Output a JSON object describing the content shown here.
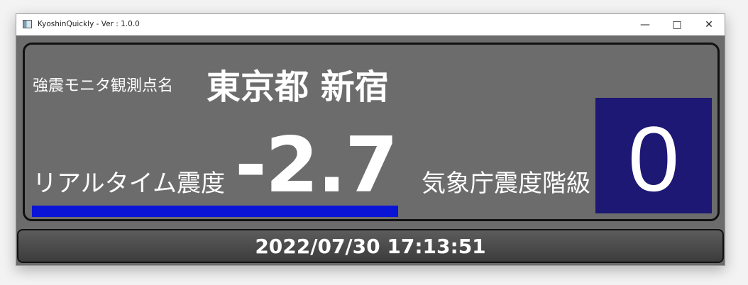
{
  "window": {
    "title": "KyoshinQuickly - Ver : 1.0.0",
    "icon": "app-window-icon",
    "controls": {
      "minimize": "—",
      "maximize": "□",
      "close": "✕"
    }
  },
  "station": {
    "label": "強震モニタ観測点名",
    "name": "東京都 新宿"
  },
  "realtime": {
    "label": "リアルタイム震度",
    "value": "-2.7",
    "bar_color": "#0a14d6"
  },
  "jma": {
    "label": "気象庁震度階級",
    "value": "0",
    "box_color": "#1c1873"
  },
  "status": {
    "timestamp": "2022/07/30 17:13:51"
  },
  "colors": {
    "panel_background": "#6c6c6c",
    "border": "#111111"
  }
}
